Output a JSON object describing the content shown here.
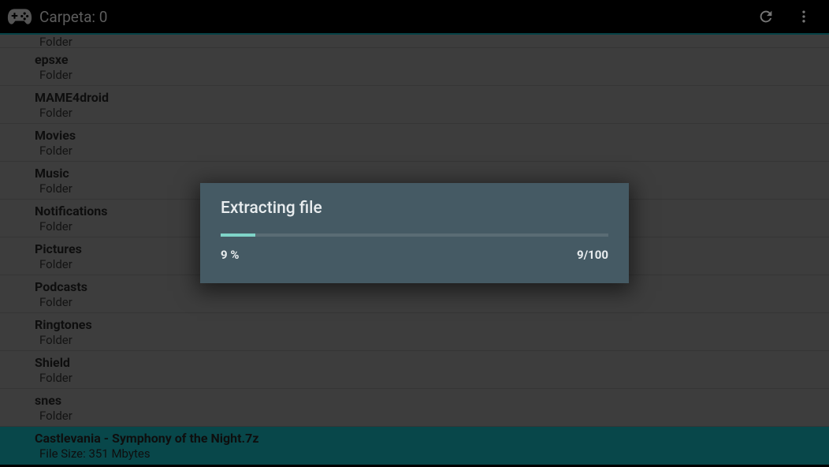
{
  "actionbar": {
    "title": "Carpeta: 0"
  },
  "folder_label": "Folder",
  "items": [
    {
      "title": "",
      "sub": "Folder",
      "sel": false,
      "partial": "top"
    },
    {
      "title": "epsxe",
      "sub": "Folder",
      "sel": false
    },
    {
      "title": "MAME4droid",
      "sub": "Folder",
      "sel": false
    },
    {
      "title": "Movies",
      "sub": "Folder",
      "sel": false
    },
    {
      "title": "Music",
      "sub": "Folder",
      "sel": false
    },
    {
      "title": "Notifications",
      "sub": "Folder",
      "sel": false
    },
    {
      "title": "Pictures",
      "sub": "Folder",
      "sel": false
    },
    {
      "title": "Podcasts",
      "sub": "Folder",
      "sel": false
    },
    {
      "title": "Ringtones",
      "sub": "Folder",
      "sel": false
    },
    {
      "title": "Shield",
      "sub": "Folder",
      "sel": false
    },
    {
      "title": "snes",
      "sub": "Folder",
      "sel": false
    },
    {
      "title": "Castlevania - Symphony of the Night.7z",
      "sub": "File Size: 351 Mbytes",
      "sel": true,
      "partial": "bottom"
    }
  ],
  "dialog": {
    "title": "Extracting file",
    "percent_text": "9 %",
    "count_text": "9/100",
    "percent": 9
  }
}
